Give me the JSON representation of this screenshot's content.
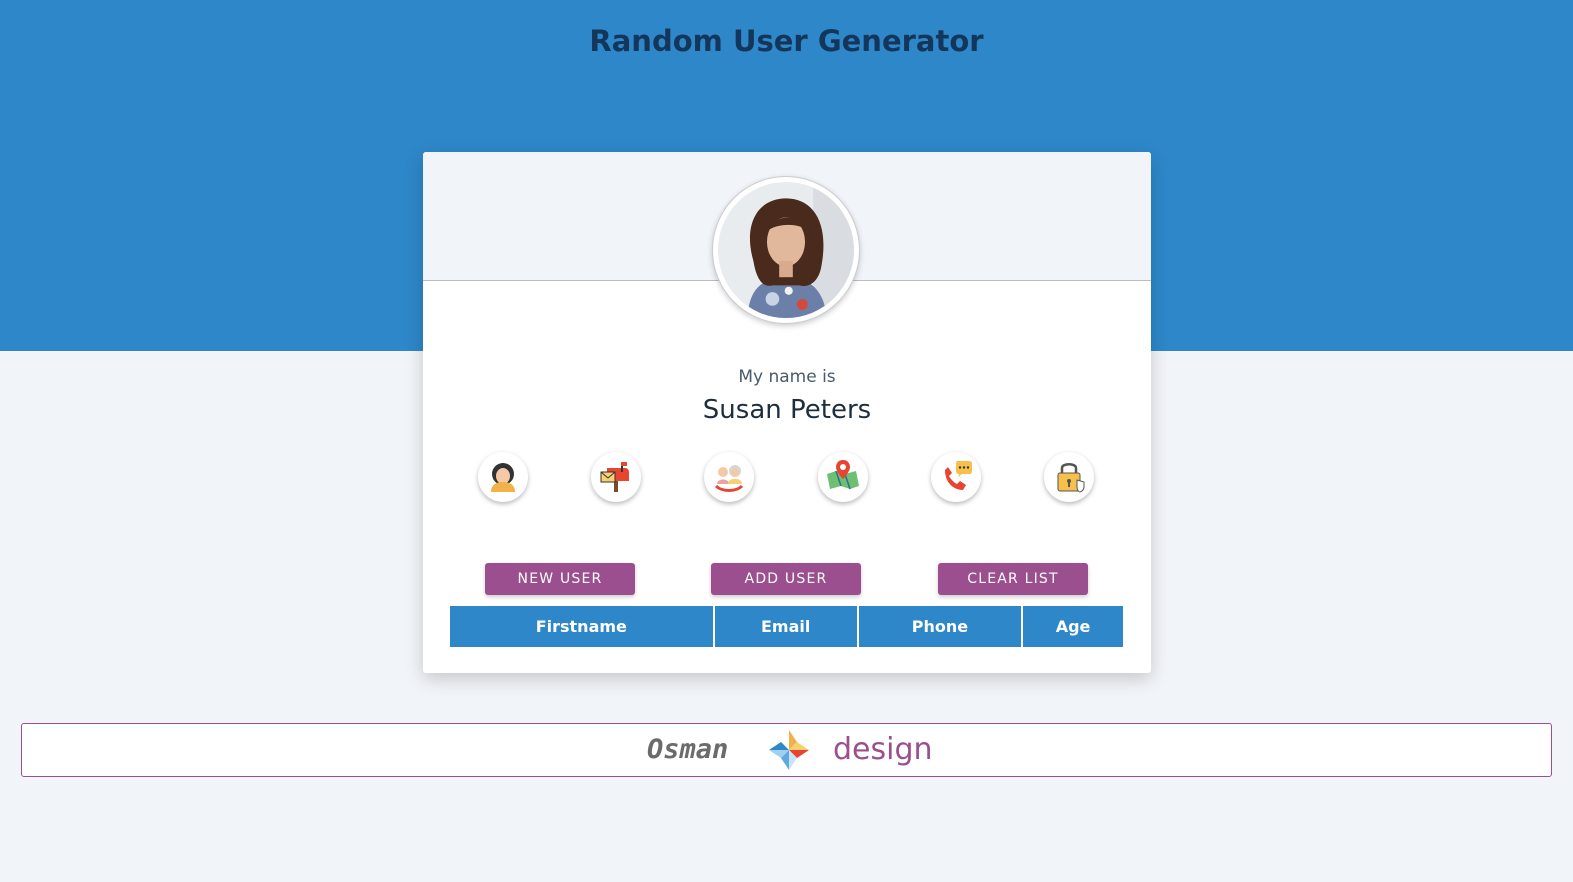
{
  "header": {
    "title": "Random User Generator"
  },
  "profile": {
    "name_label": "My name is",
    "name": "Susan Peters",
    "avatar_alt": "user photo"
  },
  "info_icons": [
    {
      "name": "user-icon"
    },
    {
      "name": "mailbox-icon"
    },
    {
      "name": "age-icon"
    },
    {
      "name": "location-map-icon"
    },
    {
      "name": "phone-icon"
    },
    {
      "name": "password-lock-icon"
    }
  ],
  "actions": {
    "new_user": "NEW USER",
    "add_user": "ADD USER",
    "clear_list": "CLEAR LIST"
  },
  "table": {
    "columns": [
      "Firstname",
      "Email",
      "Phone",
      "Age"
    ],
    "rows": []
  },
  "footer": {
    "brand_left": "Osman",
    "brand_right": "design"
  },
  "colors": {
    "primary_blue": "#2e87c9",
    "accent_purple": "#9b4f8e",
    "background": "#f1f4f8",
    "title_navy": "#14365a"
  }
}
